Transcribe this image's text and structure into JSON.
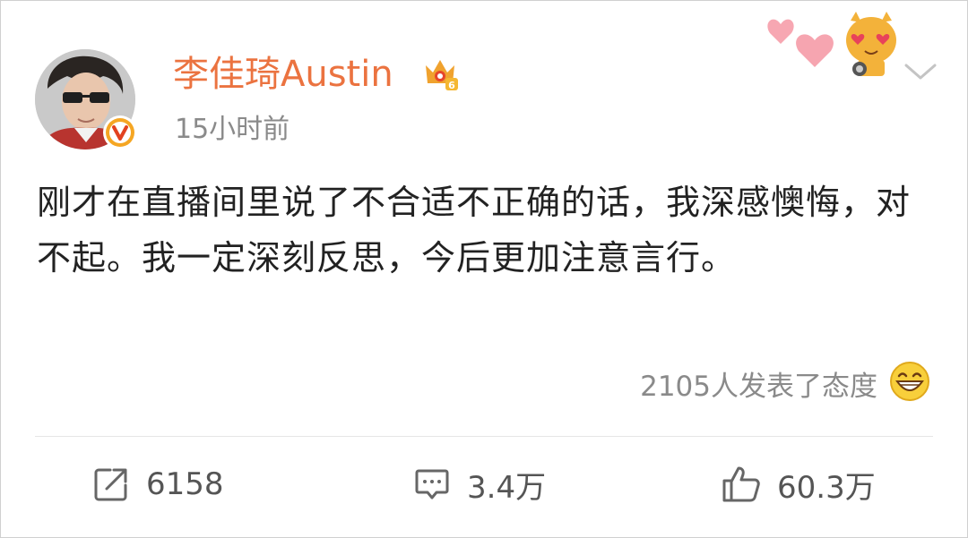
{
  "post": {
    "author": "李佳琦Austin",
    "time": "15小时前",
    "text": "刚才在直播间里说了不合适不正确的话，我深感懊悔，对不起。我一定深刻反思，今后更加注意言行。",
    "reaction_summary": "2105人发表了态度"
  },
  "actions": {
    "repost_count": "6158",
    "comment_count": "3.4万",
    "like_count": "60.3万"
  },
  "icons": {
    "avatar": "user-avatar",
    "verified": "verified-v-badge",
    "vip": "vip-crown-badge",
    "decoration": "heart-cat-sticker",
    "menu": "chevron-down-icon",
    "reaction": "laughing-emoji-icon",
    "repost": "repost-icon",
    "comment": "comment-icon",
    "like": "thumbs-up-icon"
  },
  "colors": {
    "username": "#eb7340",
    "verified_badge": "#f5a623",
    "muted_text": "#8a8a8a",
    "body_text": "#222222"
  }
}
